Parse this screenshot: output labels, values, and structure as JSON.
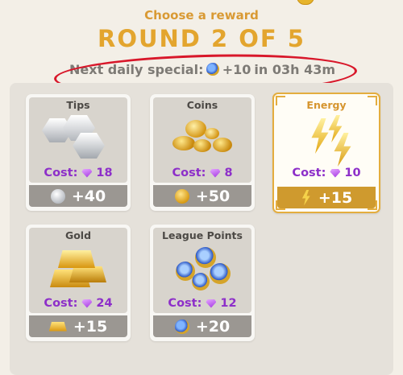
{
  "header": {
    "subtitle": "Choose a reward",
    "round_title": "ROUND 2 OF 5",
    "daily_prefix": "Next daily special:",
    "daily_amount": "+10",
    "daily_suffix": "in 03h 43m"
  },
  "colors": {
    "accent": "#e3a52e",
    "cost_purple": "#8d2fc9",
    "reward_bar_gray": "#9b9792",
    "reward_bar_gold": "#cf9a2e",
    "annotation_red": "#d8172a"
  },
  "rewards": [
    {
      "name": "Tips",
      "cost": "18",
      "amount": "+40",
      "icon": "silver-coins-icon",
      "highlighted": false
    },
    {
      "name": "Coins",
      "cost": "8",
      "amount": "+50",
      "icon": "gold-coins-icon",
      "highlighted": false
    },
    {
      "name": "Energy",
      "cost": "10",
      "amount": "+15",
      "icon": "lightning-bolts-icon",
      "highlighted": true
    },
    {
      "name": "Gold",
      "cost": "24",
      "amount": "+15",
      "icon": "gold-bars-icon",
      "highlighted": false
    },
    {
      "name": "League Points",
      "cost": "12",
      "amount": "+20",
      "icon": "league-medals-icon",
      "highlighted": false
    }
  ],
  "cost_label": "Cost:"
}
